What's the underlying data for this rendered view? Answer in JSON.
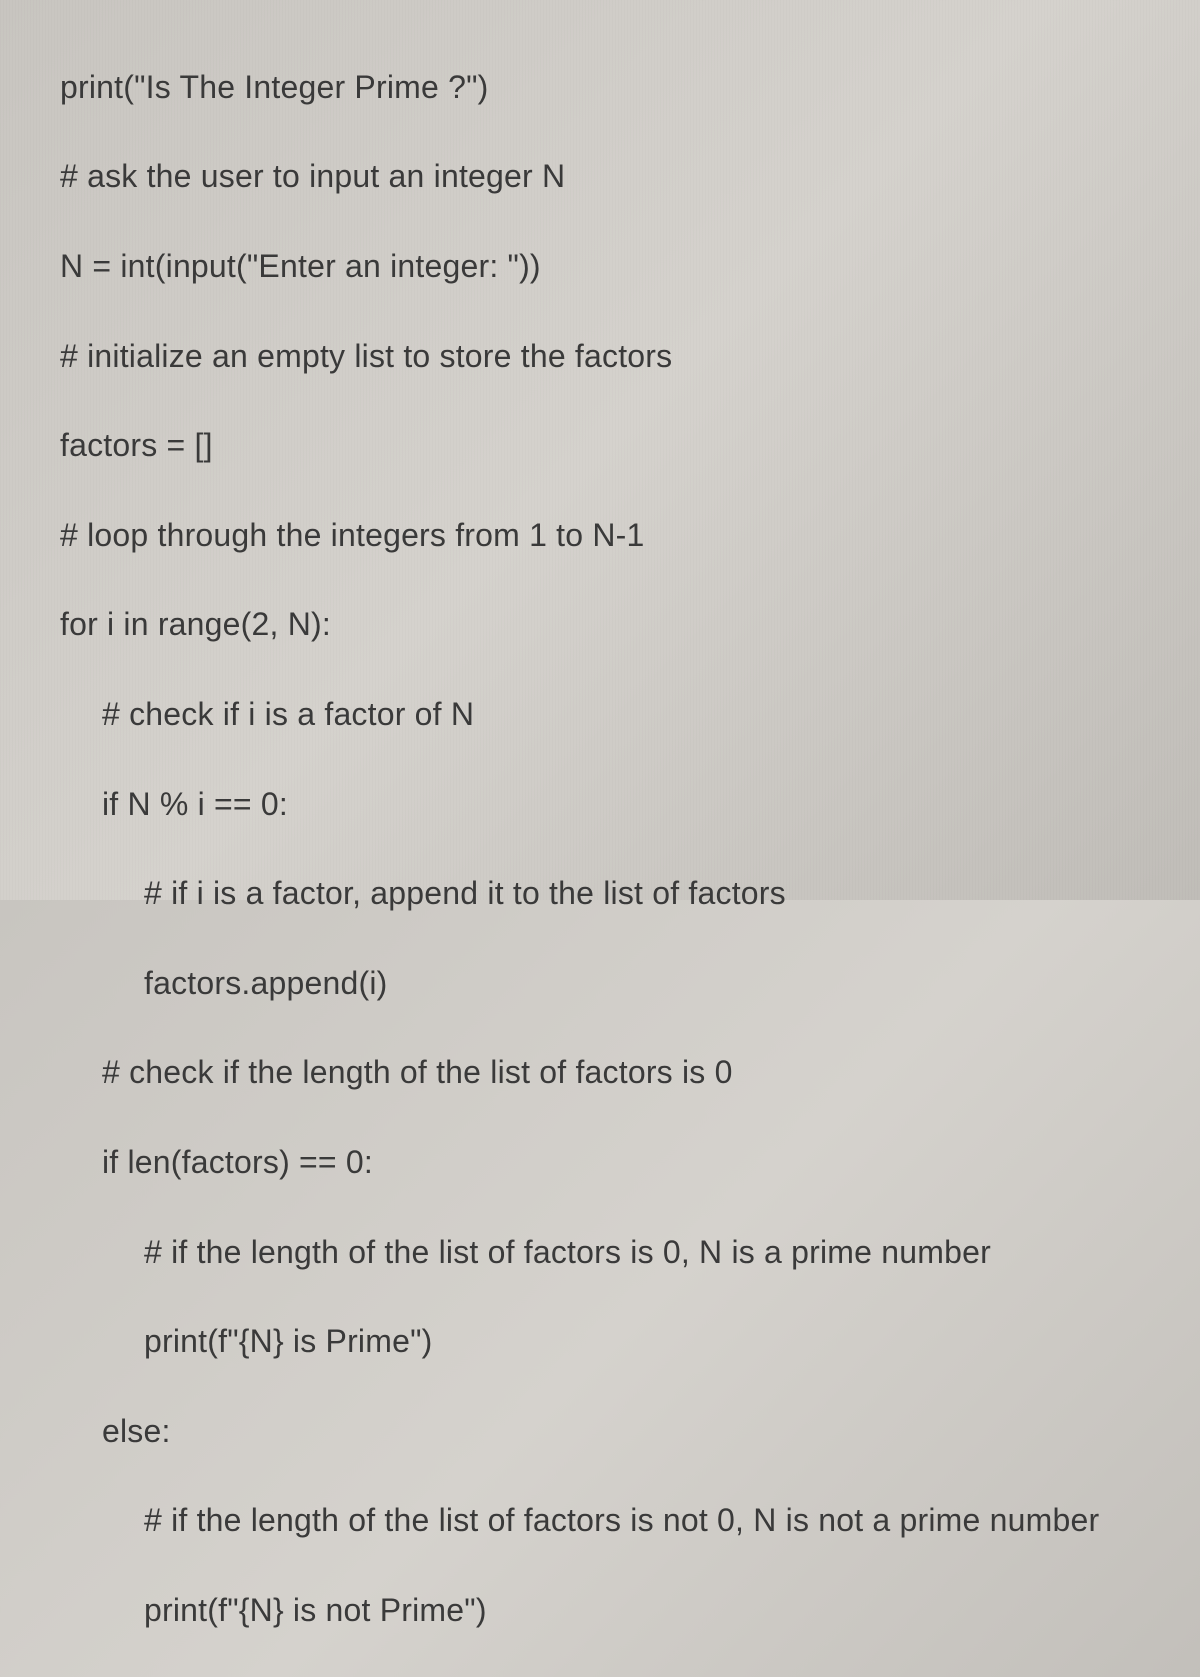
{
  "code": {
    "l1": "print(\"Is The Integer Prime ?\")",
    "l2": "# ask the user to input an integer N",
    "l3": "N = int(input(\"Enter an integer: \"))",
    "l4": "# initialize an empty list to store the factors",
    "l5": "factors = []",
    "l6": "# loop through the integers from 1 to N-1",
    "l7": "for i in range(2, N):",
    "l8": "# check if i is a factor of N",
    "l9": "if N % i == 0:",
    "l10": "# if i is a factor, append it to the list of factors",
    "l11": "factors.append(i)",
    "l12": "# check if the length of the list of factors is 0",
    "l13": "if len(factors) == 0:",
    "l14": "# if the length of the list of factors is 0, N is a prime number",
    "l15": "print(f\"{N} is Prime\")",
    "l16": "else:",
    "l17": "# if the length of the list of factors is not 0, N is not a prime number",
    "l18": "print(f\"{N} is not Prime\")"
  }
}
